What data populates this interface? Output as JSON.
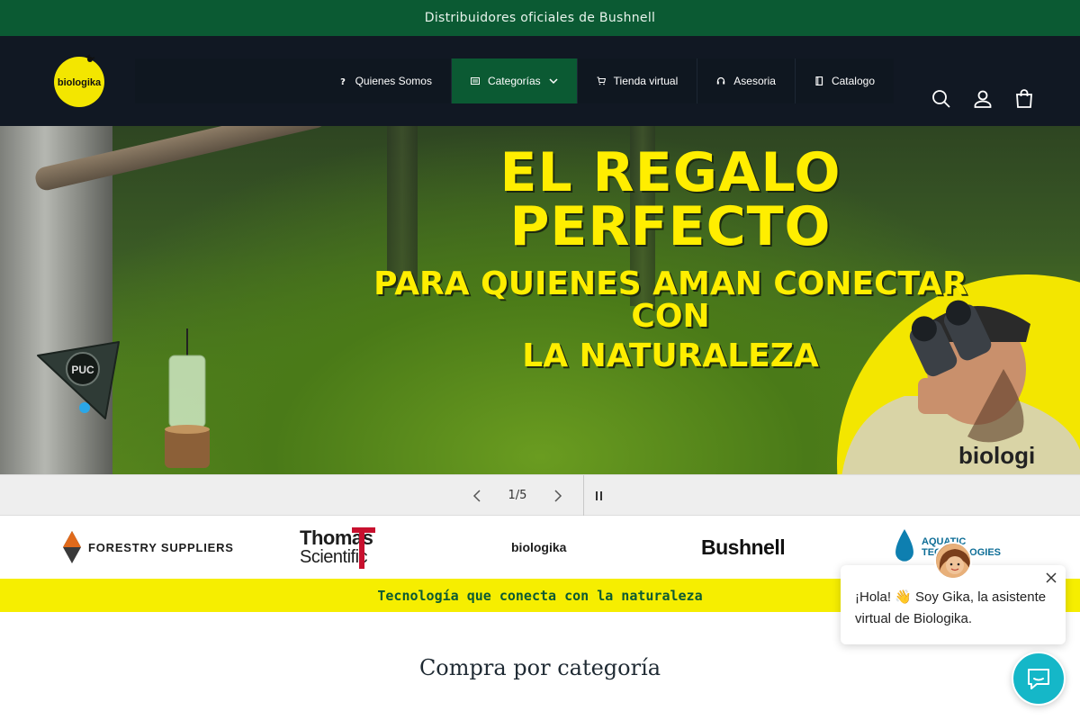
{
  "announcement": {
    "text": "Distribuidores oficiales de Bushnell"
  },
  "header": {
    "logo_text": "biologika",
    "nav": [
      {
        "label": "Quienes Somos",
        "icon": "question-icon"
      },
      {
        "label": "Categorías",
        "icon": "list-icon",
        "active": true,
        "has_dropdown": true
      },
      {
        "label": "Tienda virtual",
        "icon": "cart-icon"
      },
      {
        "label": "Asesoria",
        "icon": "headset-icon"
      },
      {
        "label": "Catalogo",
        "icon": "book-icon"
      }
    ],
    "icons": [
      "search-icon",
      "account-icon",
      "cart-icon"
    ]
  },
  "hero": {
    "headline_line1": "EL REGALO PERFECTO",
    "headline_line2": "PARA QUIENES AMAN CONECTAR CON",
    "headline_line3": "LA NATURALEZA",
    "device_label": "PUC",
    "shirt_text": "biologi"
  },
  "slider": {
    "counter": "1/5"
  },
  "brands": {
    "forestry": "FORESTRY SUPPLIERS",
    "thomas_line1": "Thomas",
    "thomas_line2": "Scientific",
    "biologika": "biologika",
    "bushnell": "Bushnell",
    "aquatic_line1": "AQUATIC",
    "aquatic_line2": "TECHNOLOGIES"
  },
  "tagline": "Tecnología que conecta con la naturaleza",
  "section": {
    "title": "Compra por categoría"
  },
  "chat": {
    "message": "¡Hola! 👋 Soy Gika, la asistente virtual de Biologika."
  },
  "colors": {
    "brand_green": "#0b5a33",
    "header_dark": "#111823",
    "brand_yellow": "#f6ee00",
    "chat_cyan": "#15b7c8"
  }
}
